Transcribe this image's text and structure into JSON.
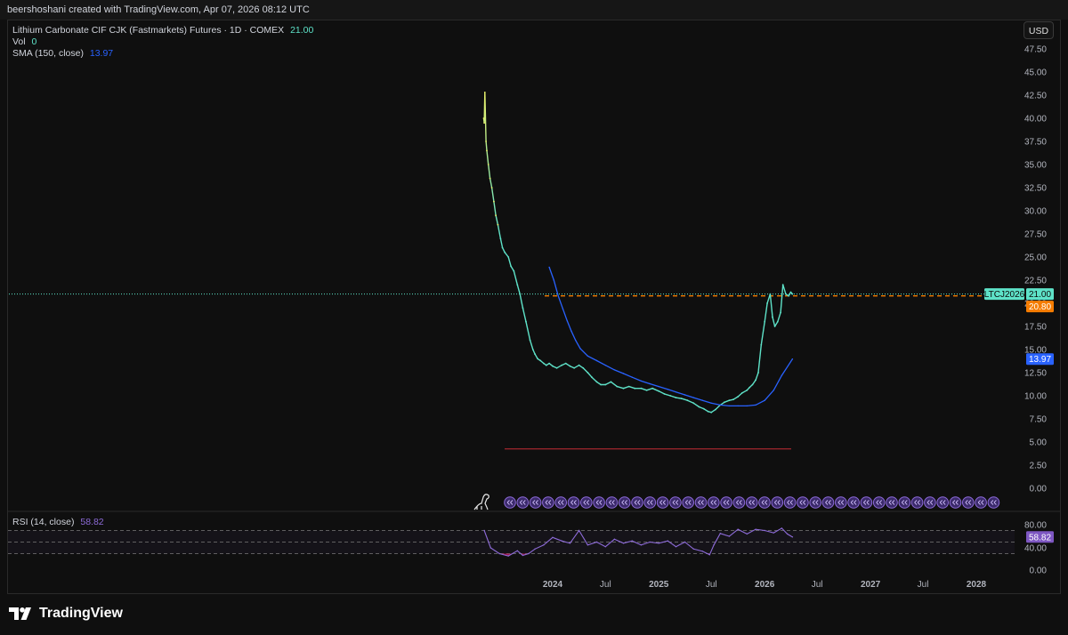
{
  "header": {
    "credit": "beershoshani created with TradingView.com, Apr 07, 2026 08:12 UTC"
  },
  "legend": {
    "symbol": "Lithium Carbonate CIF CJK (Fastmarkets) Futures · 1D · COMEX",
    "last": "21.00",
    "vol_label": "Vol",
    "vol_value": "0",
    "sma_label": "SMA (150, close)",
    "sma_value": "13.97",
    "rsi_label": "RSI (14, close)",
    "rsi_value": "58.82"
  },
  "currency_button": "USD",
  "badges": {
    "ticker": "LTCJ2026",
    "last_price": "21.00",
    "settle_price": "20.80",
    "sma_price": "13.97",
    "rsi": "58.82"
  },
  "colors": {
    "price_line": "#5ee2c8",
    "price_early": "#e8f06a",
    "sma": "#2962ff",
    "rsi": "#8d6bd8",
    "red_line": "#e0313a",
    "settle": "#f57c00",
    "rsi_oversold_fill": "#c2185b"
  },
  "brand": {
    "name": "TradingView",
    "icon": "tradingview-logo-icon"
  },
  "chart_data": [
    {
      "type": "line",
      "title": "Lithium Carbonate CIF CJK (Fastmarkets) Futures · 1D · COMEX",
      "x_ticks": [
        "2024",
        "Jul",
        "2025",
        "Jul",
        "2026",
        "Jul",
        "2027",
        "Jul",
        "2028"
      ],
      "y_ticks": [
        "47.50",
        "45.00",
        "42.50",
        "40.00",
        "37.50",
        "35.00",
        "32.50",
        "30.00",
        "27.50",
        "25.00",
        "22.50",
        "20.00",
        "17.50",
        "15.00",
        "12.50",
        "10.00",
        "7.50",
        "5.00",
        "2.50",
        "0.00"
      ],
      "ylim": [
        0,
        47.5
      ],
      "grid": false,
      "series": [
        {
          "name": "Lithium Carbonate CIF CJK (Fastmarkets) Futures",
          "x": [
            "2023-05-08",
            "2023-05-10",
            "2023-05-12",
            "2023-05-16",
            "2023-05-19",
            "2023-05-24",
            "2023-05-30",
            "2023-06-05",
            "2023-06-12",
            "2023-06-19",
            "2023-06-26",
            "2023-07-05",
            "2023-07-12",
            "2023-07-20",
            "2023-08-01",
            "2023-08-10",
            "2023-08-20",
            "2023-09-01",
            "2023-09-10",
            "2023-09-20",
            "2023-10-01",
            "2023-10-15",
            "2023-10-25",
            "2023-11-01",
            "2023-11-10",
            "2023-11-20",
            "2023-12-01",
            "2023-12-10",
            "2023-12-20",
            "2024-01-01",
            "2024-01-15",
            "2024-02-01",
            "2024-02-15",
            "2024-03-01",
            "2024-03-15",
            "2024-04-01",
            "2024-04-15",
            "2024-05-01",
            "2024-05-15",
            "2024-06-01",
            "2024-06-15",
            "2024-07-01",
            "2024-07-20",
            "2024-08-10",
            "2024-09-01",
            "2024-09-20",
            "2024-10-10",
            "2024-11-01",
            "2024-11-20",
            "2024-12-10",
            "2025-01-01",
            "2025-01-20",
            "2025-02-10",
            "2025-03-01",
            "2025-03-20",
            "2025-04-10",
            "2025-05-01",
            "2025-05-20",
            "2025-06-05",
            "2025-06-20",
            "2025-07-01",
            "2025-07-15",
            "2025-08-01",
            "2025-08-15",
            "2025-09-01",
            "2025-09-15",
            "2025-10-01",
            "2025-10-15",
            "2025-11-01",
            "2025-11-10",
            "2025-11-20",
            "2025-12-01",
            "2025-12-10",
            "2025-12-20",
            "2026-01-01",
            "2026-01-10",
            "2026-01-20",
            "2026-01-28",
            "2026-02-05",
            "2026-02-15",
            "2026-02-25",
            "2026-03-05",
            "2026-03-15",
            "2026-03-25",
            "2026-04-01",
            "2026-04-07"
          ],
          "y": [
            40.0,
            39.5,
            42.8,
            37.5,
            36.5,
            35.0,
            33.5,
            32.5,
            31.0,
            29.5,
            28.5,
            27.0,
            26.0,
            25.5,
            25.0,
            24.0,
            23.5,
            22.0,
            21.0,
            19.5,
            18.0,
            16.0,
            15.0,
            14.5,
            14.0,
            13.8,
            13.5,
            13.3,
            13.5,
            13.2,
            13.0,
            13.3,
            13.5,
            13.2,
            13.0,
            13.3,
            13.0,
            12.5,
            12.0,
            11.5,
            11.2,
            11.2,
            11.5,
            11.0,
            10.8,
            11.0,
            10.8,
            10.8,
            10.6,
            10.8,
            10.5,
            10.2,
            10.0,
            9.8,
            9.7,
            9.5,
            9.2,
            8.8,
            8.6,
            8.3,
            8.2,
            8.5,
            9.0,
            9.3,
            9.5,
            9.6,
            9.9,
            10.3,
            10.6,
            10.9,
            11.2,
            11.7,
            12.5,
            15.5,
            18.0,
            20.0,
            21.0,
            18.5,
            17.5,
            18.0,
            19.0,
            22.0,
            21.0,
            20.8,
            21.2,
            21.0
          ]
        },
        {
          "name": "SMA (150, close)",
          "x": [
            "2023-12-20",
            "2024-01-05",
            "2024-01-20",
            "2024-02-05",
            "2024-02-20",
            "2024-03-05",
            "2024-03-20",
            "2024-04-05",
            "2024-05-01",
            "2024-06-01",
            "2024-07-01",
            "2024-08-01",
            "2024-09-01",
            "2024-10-01",
            "2024-11-01",
            "2024-12-01",
            "2025-01-01",
            "2025-02-01",
            "2025-03-01",
            "2025-04-01",
            "2025-05-01",
            "2025-06-01",
            "2025-07-01",
            "2025-08-01",
            "2025-09-01",
            "2025-10-01",
            "2025-11-01",
            "2025-12-01",
            "2026-01-01",
            "2026-02-01",
            "2026-03-01",
            "2026-04-07"
          ],
          "y": [
            23.9,
            22.5,
            20.8,
            19.4,
            18.1,
            17.0,
            16.0,
            15.1,
            14.3,
            13.8,
            13.3,
            12.8,
            12.4,
            12.0,
            11.6,
            11.3,
            11.0,
            10.7,
            10.4,
            10.1,
            9.8,
            9.5,
            9.2,
            9.0,
            8.9,
            8.9,
            8.9,
            9.0,
            9.5,
            10.6,
            12.2,
            13.97
          ]
        }
      ],
      "reference_lines": [
        {
          "y": 21.0,
          "style": "dotted",
          "color": "#5ee2c8"
        },
        {
          "y": 20.8,
          "style": "dashed",
          "color": "#f57c00"
        },
        {
          "y": 4.25,
          "style": "solid",
          "color": "#e0313a"
        }
      ]
    },
    {
      "type": "line",
      "title": "RSI (14, close)",
      "ylim": [
        20,
        90
      ],
      "y_ticks": [
        "80.00",
        "40.00",
        "0.00"
      ],
      "bands": [
        70,
        50,
        30
      ],
      "series": [
        {
          "name": "RSI (14, close)",
          "x": [
            "2023-05-10",
            "2023-06-01",
            "2023-07-01",
            "2023-08-01",
            "2023-09-01",
            "2023-09-20",
            "2023-10-10",
            "2023-11-01",
            "2023-12-01",
            "2024-01-01",
            "2024-02-01",
            "2024-03-01",
            "2024-04-01",
            "2024-05-01",
            "2024-06-01",
            "2024-07-01",
            "2024-08-01",
            "2024-09-01",
            "2024-10-01",
            "2024-11-01",
            "2024-12-01",
            "2025-01-01",
            "2025-02-01",
            "2025-03-01",
            "2025-04-01",
            "2025-05-01",
            "2025-06-01",
            "2025-06-25",
            "2025-07-10",
            "2025-08-01",
            "2025-09-01",
            "2025-10-01",
            "2025-11-01",
            "2025-12-01",
            "2026-01-01",
            "2026-02-01",
            "2026-03-01",
            "2026-03-20",
            "2026-04-07"
          ],
          "y": [
            70,
            40,
            30,
            26,
            35,
            27,
            30,
            38,
            45,
            58,
            52,
            48,
            70,
            45,
            50,
            42,
            55,
            48,
            52,
            45,
            50,
            48,
            52,
            42,
            50,
            38,
            34,
            28,
            45,
            65,
            60,
            72,
            64,
            72,
            70,
            66,
            74,
            64,
            58.82
          ]
        }
      ]
    }
  ]
}
